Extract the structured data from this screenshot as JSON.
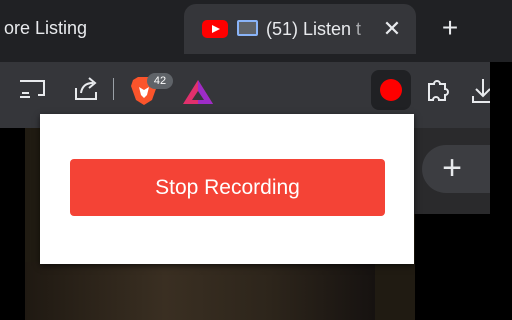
{
  "tabs": {
    "inactive_title": "ore Listing",
    "active_title": "(51) Listen t",
    "close_symbol": "✕",
    "new_tab_symbol": "+"
  },
  "toolbar": {
    "brave_badge": "42",
    "icons": [
      "screen-cast-icon",
      "share-icon",
      "brave-shields-icon",
      "brave-rewards-icon",
      "record-icon",
      "puzzle-icon",
      "download-icon"
    ]
  },
  "popup": {
    "stop_label": "Stop Recording"
  },
  "page": {
    "add_symbol": "+"
  },
  "colors": {
    "record_red": "#ff0000",
    "stop_button": "#f44336",
    "tab_active_bg": "#35363a",
    "tabstrip_bg": "#202124"
  }
}
